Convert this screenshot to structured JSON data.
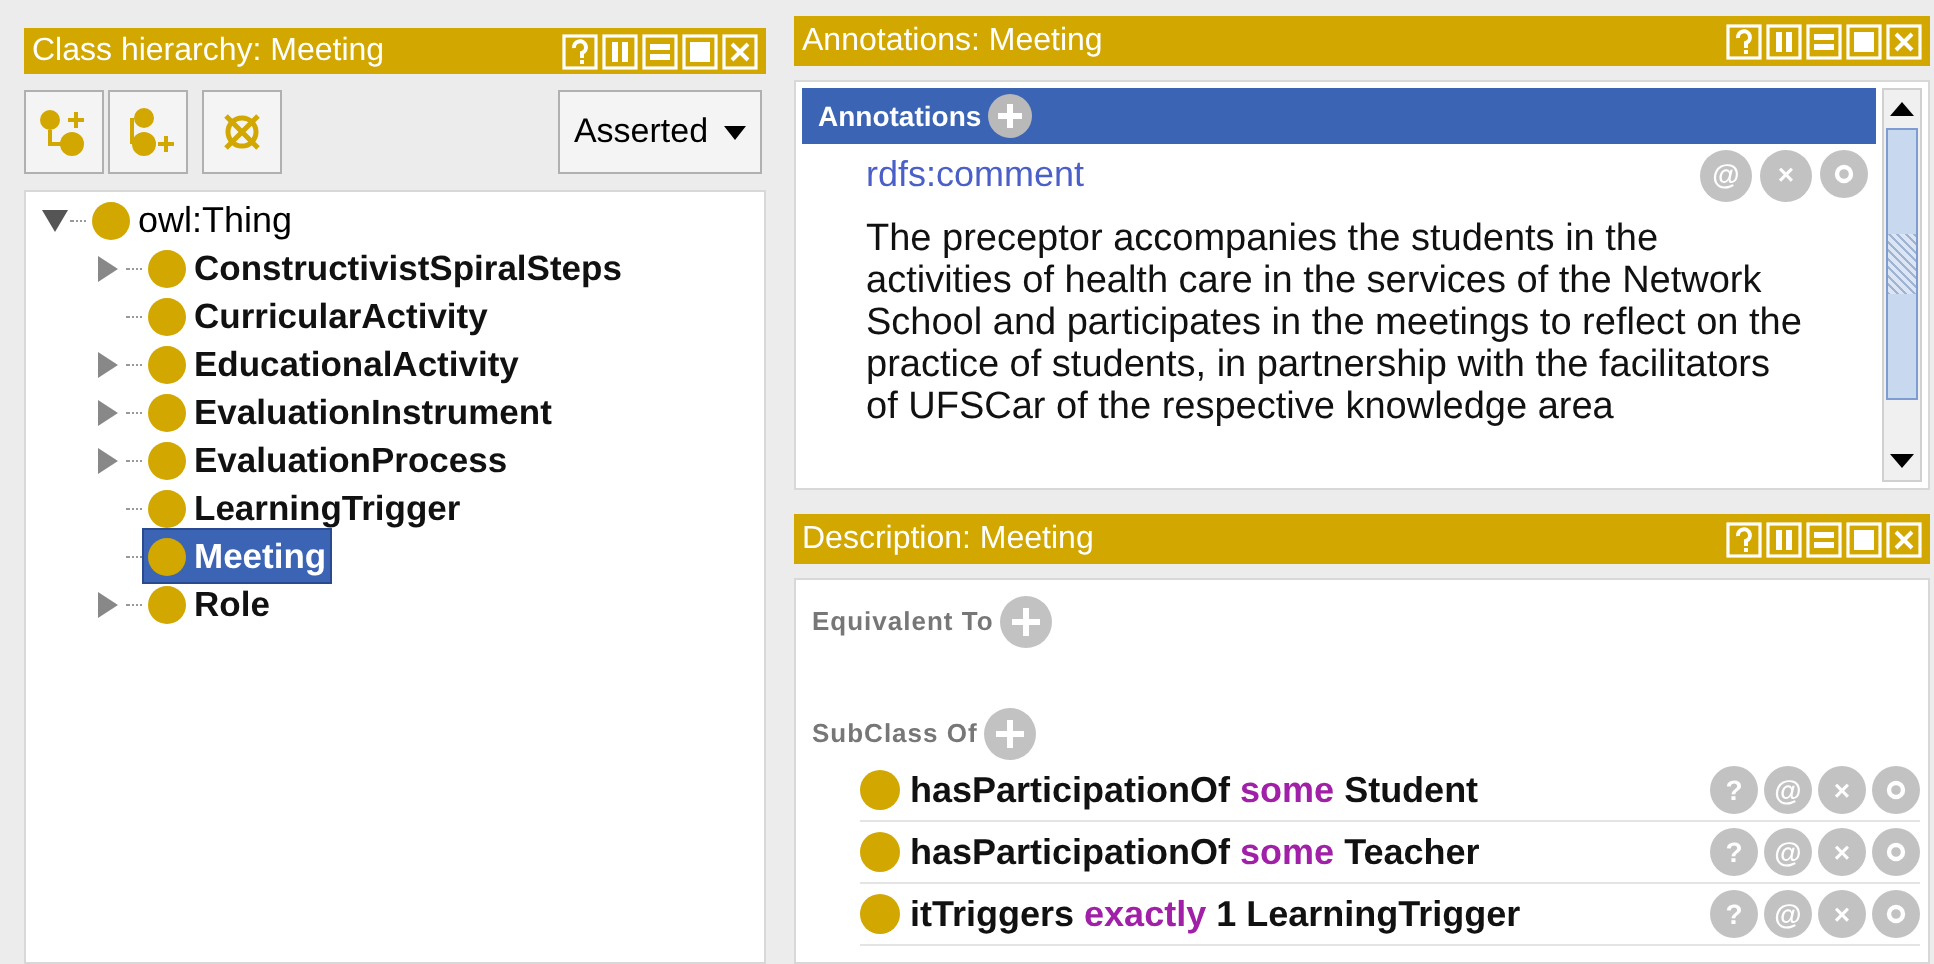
{
  "class_hierarchy": {
    "title": "Class hierarchy: Meeting",
    "view_selector": "Asserted",
    "tree": {
      "label": "owl:Thing",
      "expandable": true,
      "expanded": true,
      "selected": false,
      "children": [
        {
          "label": "ConstructivistSpiralSteps",
          "expandable": true,
          "expanded": false,
          "selected": false
        },
        {
          "label": "CurricularActivity",
          "expandable": false,
          "selected": false
        },
        {
          "label": "EducationalActivity",
          "expandable": true,
          "expanded": false,
          "selected": false
        },
        {
          "label": "EvaluationInstrument",
          "expandable": true,
          "expanded": false,
          "selected": false
        },
        {
          "label": "EvaluationProcess",
          "expandable": true,
          "expanded": false,
          "selected": false
        },
        {
          "label": "LearningTrigger",
          "expandable": false,
          "selected": false
        },
        {
          "label": "Meeting",
          "expandable": false,
          "selected": true
        },
        {
          "label": "Role",
          "expandable": true,
          "expanded": false,
          "selected": false
        }
      ]
    }
  },
  "annotations": {
    "title": "Annotations: Meeting",
    "section_label": "Annotations",
    "items": [
      {
        "property": "rdfs:comment",
        "actions": [
          "@",
          "×"
        ],
        "value": "The preceptor accompanies the students in the activities of health care in the services of the Network School and participates in the meetings to reflect on the practice of students, in partnership with the facilitators of UFSCar of the respective knowledge area"
      }
    ]
  },
  "description": {
    "title": "Description: Meeting",
    "sections": [
      {
        "label": "Equivalent To"
      },
      {
        "label": "SubClass Of",
        "items": [
          {
            "actions": [
              "?",
              "@",
              "×"
            ],
            "tokens": [
              {
                "text": "hasParticipationOf",
                "kind": "entity"
              },
              {
                "text": "some",
                "kind": "keyword"
              },
              {
                "text": "Student",
                "kind": "entity"
              }
            ]
          },
          {
            "actions": [
              "?",
              "@",
              "×"
            ],
            "tokens": [
              {
                "text": "hasParticipationOf",
                "kind": "entity"
              },
              {
                "text": "some",
                "kind": "keyword"
              },
              {
                "text": "Teacher",
                "kind": "entity"
              }
            ]
          },
          {
            "actions": [
              "?",
              "@",
              "×"
            ],
            "tokens": [
              {
                "text": "itTriggers",
                "kind": "entity"
              },
              {
                "text": "exactly",
                "kind": "keyword"
              },
              {
                "text": "1",
                "kind": "entity"
              },
              {
                "text": "LearningTrigger",
                "kind": "entity"
              }
            ]
          }
        ]
      }
    ]
  }
}
